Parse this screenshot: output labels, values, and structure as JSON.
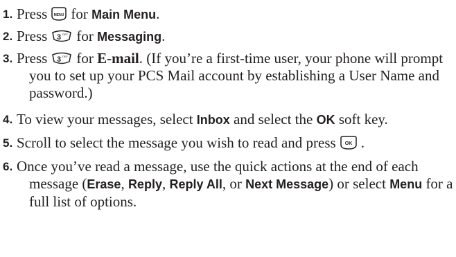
{
  "steps": [
    {
      "number": "1.",
      "parts": [
        "Press",
        "for",
        "Main Menu",
        "."
      ],
      "key_icon": "menu-key-icon",
      "key_label": "MENU"
    },
    {
      "number": "2.",
      "parts": [
        "Press",
        "for",
        "Messaging",
        "."
      ],
      "key_icon": "three-def-key-icon",
      "key_label": "3",
      "key_sub": "DEF"
    },
    {
      "number": "3.",
      "parts": [
        "Press",
        "for",
        "E-mail",
        ". (If you’re a first-time user, your phone will prompt you to set up your PCS Mail account by establishing a User Name and password.)"
      ],
      "key_icon": "three-def-key-icon",
      "key_label": "3",
      "key_sub": "DEF"
    },
    {
      "number": "4.",
      "parts": [
        "To view your messages, select",
        "Inbox",
        "and select the",
        "OK",
        "soft key."
      ]
    },
    {
      "number": "5.",
      "parts": [
        "Scroll to select the message you wish to read and press",
        "."
      ],
      "key_icon": "ok-key-icon",
      "key_label": "OK"
    },
    {
      "number": "6.",
      "parts": [
        "Once you’ve read a message, use the quick actions at the end of each message (",
        "Erase",
        ",",
        "Reply",
        ",",
        "Reply All",
        ", or",
        "Next Message",
        ") or select",
        "Menu",
        "for a full list of options."
      ]
    }
  ]
}
